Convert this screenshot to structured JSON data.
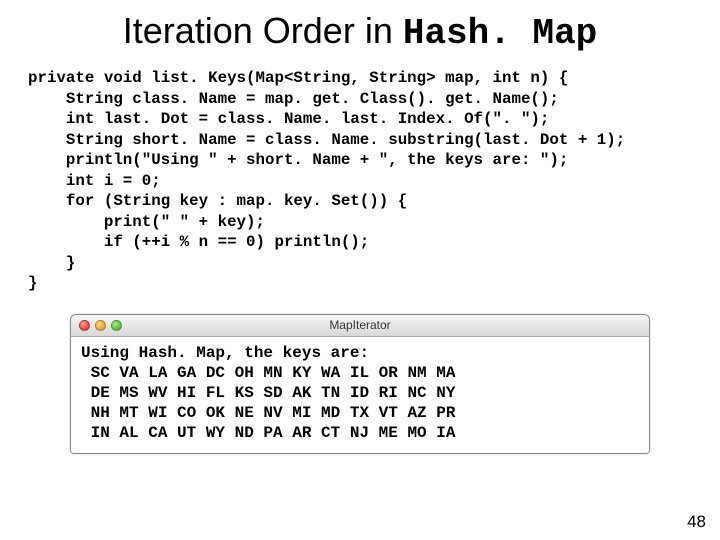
{
  "title_prefix": "Iteration Order in ",
  "title_mono": "Hash. Map",
  "code": "private void list. Keys(Map<String, String> map, int n) {\n    String class. Name = map. get. Class(). get. Name();\n    int last. Dot = class. Name. last. Index. Of(\". \");\n    String short. Name = class. Name. substring(last. Dot + 1);\n    println(\"Using \" + short. Name + \", the keys are: \");\n    int i = 0;\n    for (String key : map. key. Set()) {\n        print(\" \" + key);\n        if (++i % n == 0) println();\n    }\n}",
  "terminal": {
    "title": "MapIterator",
    "output": "Using Hash. Map, the keys are:\n SC VA LA GA DC OH MN KY WA IL OR NM MA\n DE MS WV HI FL KS SD AK TN ID RI NC NY\n NH MT WI CO OK NE NV MI MD TX VT AZ PR\n IN AL CA UT WY ND PA AR CT NJ ME MO IA"
  },
  "page_number": "48"
}
